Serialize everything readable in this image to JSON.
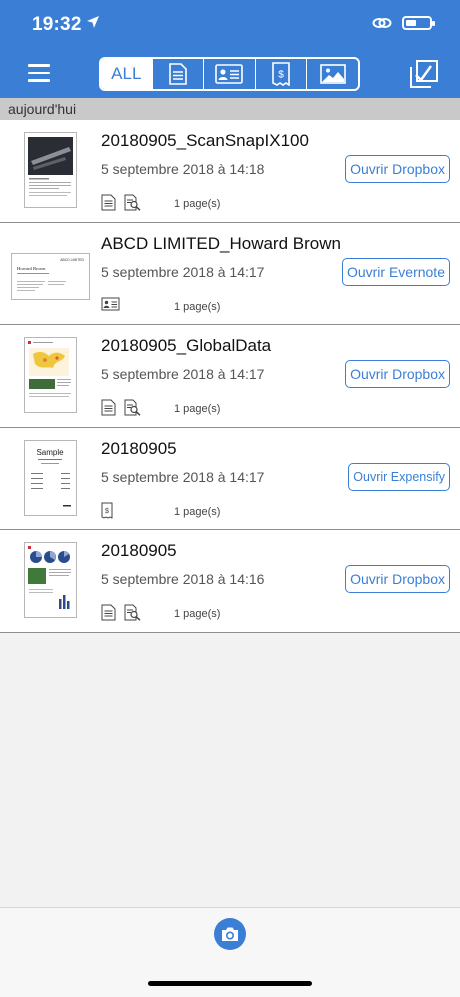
{
  "status_bar": {
    "time": "19:32"
  },
  "header": {
    "tabs": [
      {
        "label": "ALL",
        "icon": "all"
      },
      {
        "label": "",
        "icon": "document-icon"
      },
      {
        "label": "",
        "icon": "business-card-icon"
      },
      {
        "label": "",
        "icon": "receipt-icon"
      },
      {
        "label": "",
        "icon": "photo-icon"
      }
    ]
  },
  "section": {
    "title": "aujourd'hui"
  },
  "documents": [
    {
      "title": "20180905_ScanSnapIX100",
      "date": "5 septembre 2018 à 14:18",
      "pages": "1 page(s)",
      "action": "Ouvrir Dropbox"
    },
    {
      "title": "ABCD LIMITED_Howard Brown",
      "date": "5 septembre 2018 à 14:17",
      "pages": "1 page(s)",
      "action": "Ouvrir Evernote"
    },
    {
      "title": "20180905_GlobalData",
      "date": "5 septembre 2018 à 14:17",
      "pages": "1 page(s)",
      "action": "Ouvrir Dropbox"
    },
    {
      "title": "20180905",
      "date": "5 septembre 2018 à 14:17",
      "pages": "1 page(s)",
      "action": "Ouvrir Expensify"
    },
    {
      "title": "20180905",
      "date": "5 septembre 2018 à 14:16",
      "pages": "1 page(s)",
      "action": "Ouvrir Dropbox"
    }
  ],
  "thumbnails": {
    "card": {
      "company": "ABCD LIMITED",
      "name": "Howard Brown"
    },
    "sample": {
      "title": "Sample"
    }
  },
  "colors": {
    "accent": "#3a7fd5",
    "section_bg": "#c9c9c9"
  }
}
